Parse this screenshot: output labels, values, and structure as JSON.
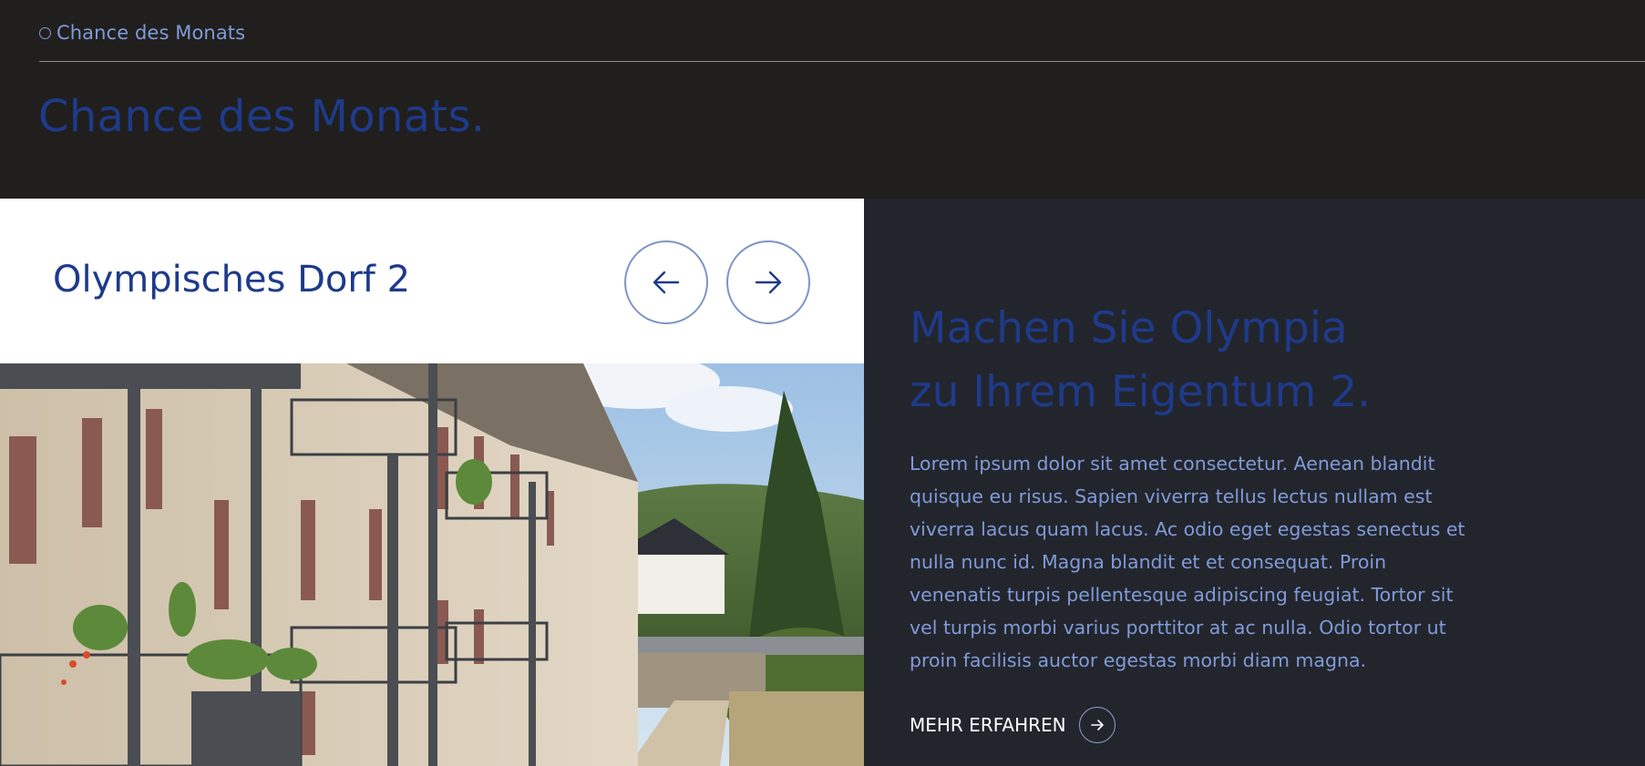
{
  "header": {
    "eyebrow_label": "Chance des Monats",
    "section_title": "Chance des Monats."
  },
  "card": {
    "title": "Olympisches Dorf 2",
    "prev_icon": "arrow-left-icon",
    "next_icon": "arrow-right-icon",
    "image_alt": "Olympisches Dorf 2"
  },
  "feature": {
    "headline_line1": "Machen Sie Olympia",
    "headline_line2": "zu Ihrem Eigentum 2.",
    "body": "Lorem ipsum dolor sit amet consectetur. Aenean blandit quisque eu risus. Sapien viverra tellus lectus nullam est viverra lacus quam lacus. Ac odio eget egestas senectus et nulla nunc id. Magna blandit et et consequat. Proin venenatis turpis pellentesque adipiscing feugiat. Tortor sit vel turpis morbi varius porttitor at ac nulla. Odio tortor ut proin facilisis auctor egestas morbi diam magna.",
    "cta_label": "MEHR ERFAHREN",
    "cta_icon": "arrow-right-icon"
  },
  "colors": {
    "background_dark": "#201f1d",
    "panel_dark": "#23252d",
    "brand_blue": "#1e3a8a",
    "light_blue": "#7f9bd8",
    "white": "#ffffff"
  }
}
